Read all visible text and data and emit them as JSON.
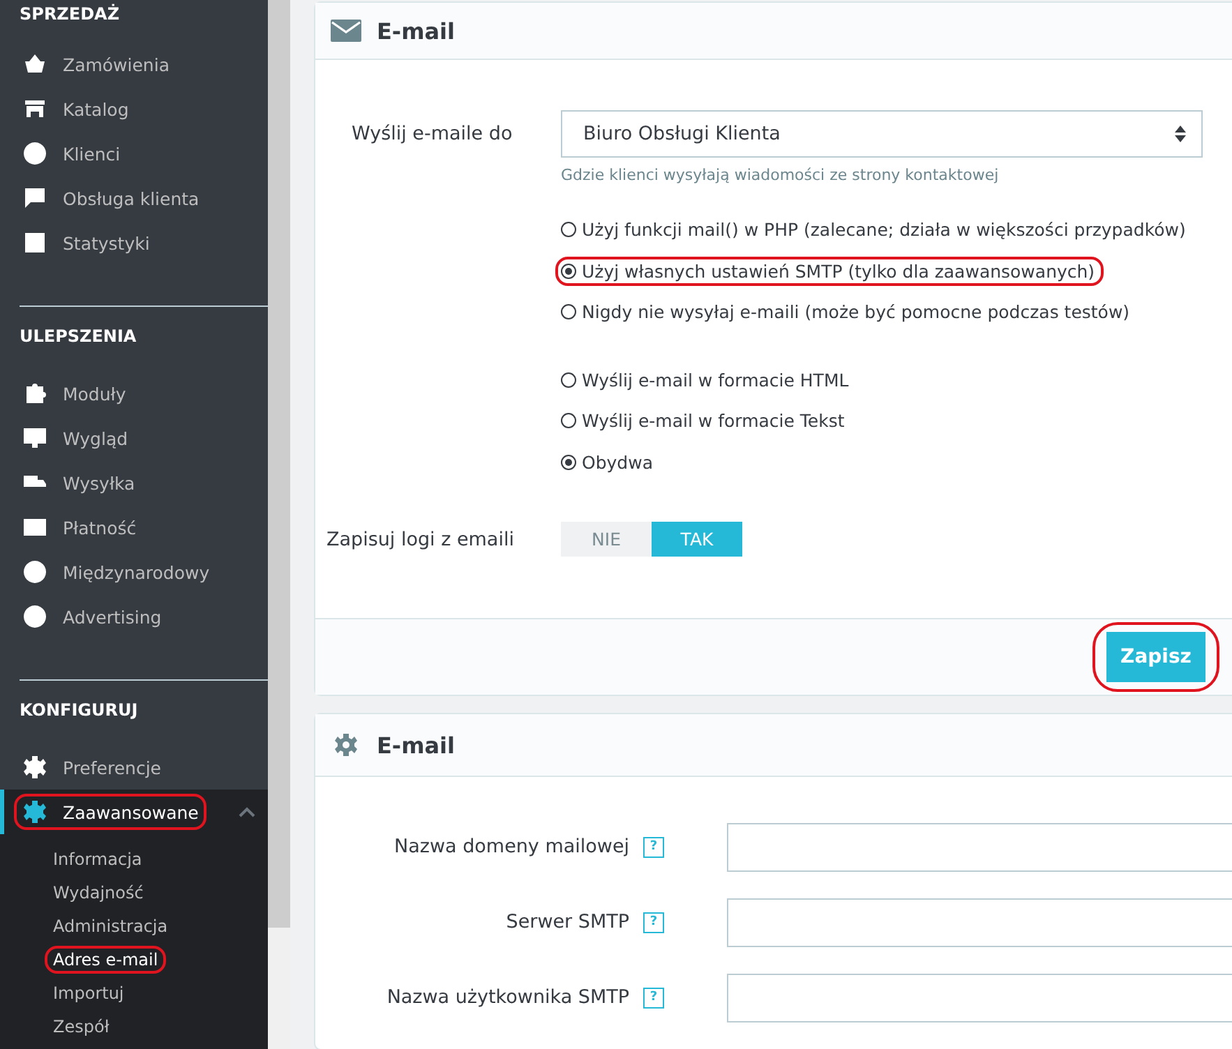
{
  "sidebar": {
    "sections": [
      {
        "title": "SPRZEDAŻ",
        "items": [
          {
            "label": "Zamówienia",
            "selected": false,
            "annotated": false
          },
          {
            "label": "Katalog",
            "selected": false,
            "annotated": false
          },
          {
            "label": "Klienci",
            "selected": false,
            "annotated": false
          },
          {
            "label": "Obsługa klienta",
            "selected": false,
            "annotated": false
          },
          {
            "label": "Statystyki",
            "selected": false,
            "annotated": false
          }
        ]
      },
      {
        "title": "ULEPSZENIA",
        "items": [
          {
            "label": "Moduły",
            "selected": false,
            "annotated": false
          },
          {
            "label": "Wygląd",
            "selected": false,
            "annotated": false
          },
          {
            "label": "Wysyłka",
            "selected": false,
            "annotated": false
          },
          {
            "label": "Płatność",
            "selected": false,
            "annotated": false
          },
          {
            "label": "Międzynarodowy",
            "selected": false,
            "annotated": false
          },
          {
            "label": "Advertising",
            "selected": false,
            "annotated": false
          }
        ]
      },
      {
        "title": "KONFIGURUJ",
        "items": [
          {
            "label": "Preferencje",
            "selected": false,
            "annotated": false
          },
          {
            "label": "Zaawansowane",
            "selected": true,
            "annotated": true,
            "expanded": true,
            "children": [
              {
                "label": "Informacja",
                "selected": false,
                "annotated": false
              },
              {
                "label": "Wydajność",
                "selected": false,
                "annotated": false
              },
              {
                "label": "Administracja",
                "selected": false,
                "annotated": false
              },
              {
                "label": "Adres e-mail",
                "selected": true,
                "annotated": true
              },
              {
                "label": "Importuj",
                "selected": false,
                "annotated": false
              },
              {
                "label": "Zespół",
                "selected": false,
                "annotated": false
              }
            ]
          }
        ]
      }
    ]
  },
  "panels": [
    {
      "kind": "mail",
      "title": "E-mail",
      "fields": [
        {
          "kind": "select",
          "label": "Wyślij e-maile do",
          "value": "Biuro Obsługi Klienta",
          "hint": "Gdzie klienci wysyłają wiadomości ze strony kontaktowej"
        },
        {
          "kind": "radios",
          "options": [
            {
              "label": "Użyj funkcji mail() w PHP (zalecane; działa w większości przypadków)",
              "selected": false,
              "annotated": false
            },
            {
              "label": "Użyj własnych ustawień SMTP (tylko dla zaawansowanych)",
              "selected": true,
              "annotated": true
            },
            {
              "label": "Nigdy nie wysyłaj e-maili (może być pomocne podczas testów)",
              "selected": false,
              "annotated": false
            }
          ]
        },
        {
          "kind": "radios",
          "options": [
            {
              "label": "Wyślij e-mail w formacie HTML",
              "selected": false,
              "annotated": false
            },
            {
              "label": "Wyślij e-mail w formacie Tekst",
              "selected": false,
              "annotated": false
            },
            {
              "label": "Obydwa",
              "selected": true,
              "annotated": false
            }
          ]
        },
        {
          "kind": "toggle",
          "label": "Zapisuj logi z emaili",
          "options": [
            {
              "label": "NIE",
              "selected": false
            },
            {
              "label": "TAK",
              "selected": true
            }
          ]
        }
      ],
      "save_button": {
        "label": "Zapisz",
        "annotated": true
      }
    },
    {
      "kind": "gear",
      "title": "E-mail",
      "fields": [
        {
          "kind": "input",
          "label": "Nazwa domeny mailowej",
          "help": "?"
        },
        {
          "kind": "input",
          "label": "Serwer SMTP",
          "help": "?"
        },
        {
          "kind": "input",
          "label": "Nazwa użytkownika SMTP",
          "help": "?"
        }
      ]
    }
  ]
}
